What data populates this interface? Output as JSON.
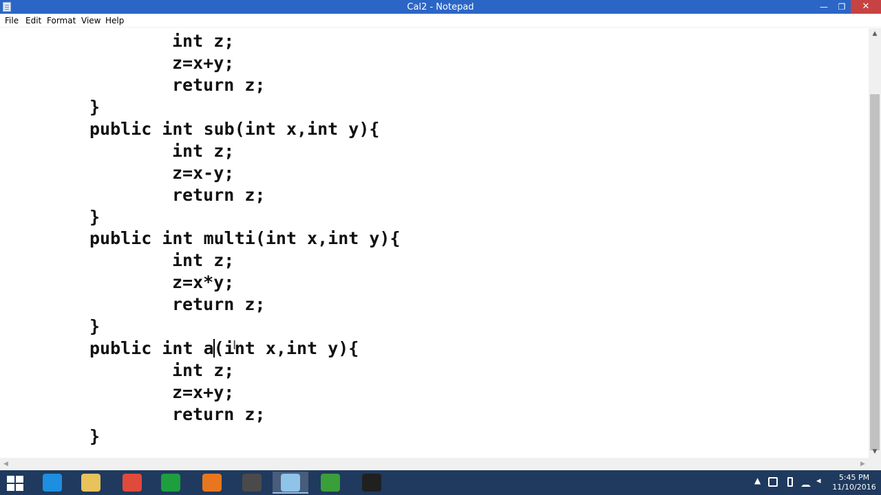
{
  "window": {
    "title": "Cal2 - Notepad",
    "minimize_glyph": "—",
    "maximize_glyph": "❐",
    "close_glyph": "✕"
  },
  "menu": {
    "items": [
      {
        "label": "File"
      },
      {
        "label": "Edit"
      },
      {
        "label": "Format"
      },
      {
        "label": "View"
      },
      {
        "label": "Help"
      }
    ]
  },
  "editor": {
    "lines": [
      "int z;",
      "z=x+y;",
      "return z;",
      "}",
      "public int sub(int x,int y){",
      "int z;",
      "z=x-y;",
      "return z;",
      "}",
      "public int multi(int x,int y){",
      "int z;",
      "z=x*y;",
      "return z;",
      "}",
      "public int a",
      "(int x,int y){",
      "int z;",
      "z=x+y;",
      "return z;",
      "}"
    ]
  },
  "scrollbar": {
    "up_glyph": "▲",
    "down_glyph": "▼",
    "left_glyph": "◀",
    "right_glyph": "▶"
  },
  "taskbar": {
    "apps": [
      {
        "name": "Internet Explorer",
        "color": "#1e8ee0",
        "active": false
      },
      {
        "name": "File Explorer",
        "color": "#e8c25a",
        "active": false
      },
      {
        "name": "Google Chrome",
        "color": "#e04a3a",
        "active": false
      },
      {
        "name": "Store",
        "color": "#1e9e3e",
        "active": false
      },
      {
        "name": "Firefox",
        "color": "#e8761e",
        "active": false
      },
      {
        "name": "Sublime Text",
        "color": "#4a4a4a",
        "active": false
      },
      {
        "name": "Notepad",
        "color": "#8fc3e8",
        "active": true
      },
      {
        "name": "Chart App",
        "color": "#3a9e3a",
        "active": false
      },
      {
        "name": "Media App",
        "color": "#202020",
        "active": false
      }
    ],
    "tray_up": "▲",
    "clock_time": "5:45 PM",
    "clock_date": "11/10/2016"
  },
  "colors": {
    "titlebar": "#2b66c6",
    "close": "#c74343",
    "taskbar": "#1f3a5e"
  }
}
